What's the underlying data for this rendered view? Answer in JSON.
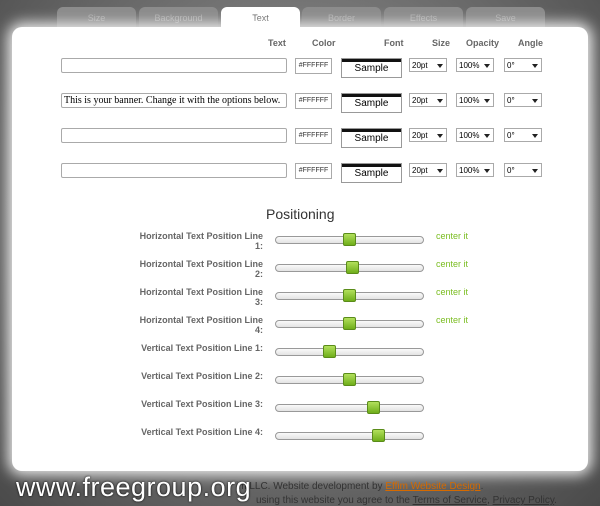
{
  "tabs": [
    "Size",
    "Background",
    "Text",
    "Border",
    "Effects",
    "Save"
  ],
  "active_tab": "Text",
  "columns": {
    "text": "Text",
    "color": "Color",
    "font": "Font",
    "size": "Size",
    "opacity": "Opacity",
    "angle": "Angle"
  },
  "rows": [
    {
      "text": "",
      "color": "#FFFFFF",
      "font": "Sample",
      "size": "20pt",
      "opacity": "100%",
      "angle": "0°"
    },
    {
      "text": "This is your banner. Change it with the options below.",
      "color": "#FFFFFF",
      "font": "Sample",
      "size": "20pt",
      "opacity": "100%",
      "angle": "0°"
    },
    {
      "text": "",
      "color": "#FFFFFF",
      "font": "Sample",
      "size": "20pt",
      "opacity": "100%",
      "angle": "0°"
    },
    {
      "text": "",
      "color": "#FFFFFF",
      "font": "Sample",
      "size": "20pt",
      "opacity": "100%",
      "angle": "0°"
    }
  ],
  "positioning": {
    "title": "Positioning",
    "center_label": "center it",
    "sliders": [
      {
        "label": "Horizontal Text Position Line 1:",
        "value": 0.5,
        "center": true
      },
      {
        "label": "Horizontal Text Position Line 2:",
        "value": 0.52,
        "center": true
      },
      {
        "label": "Horizontal Text Position Line 3:",
        "value": 0.5,
        "center": true
      },
      {
        "label": "Horizontal Text Position Line 4:",
        "value": 0.5,
        "center": true
      },
      {
        "label": "Vertical Text Position Line 1:",
        "value": 0.35,
        "center": false
      },
      {
        "label": "Vertical Text Position Line 2:",
        "value": 0.5,
        "center": false
      },
      {
        "label": "Vertical Text Position Line 3:",
        "value": 0.68,
        "center": false
      },
      {
        "label": "Vertical Text Position Line 4:",
        "value": 0.72,
        "center": false
      }
    ]
  },
  "footer": {
    "line1_prefix": "im LLC. Website development by ",
    "dev_link": "Effim Website Design",
    "line1_suffix": ".",
    "line2_prefix": "using this website you agree to the ",
    "tos_link": "Terms of Service",
    "line2_sep": ", ",
    "privacy_link": "Privacy Policy",
    "line2_suffix": "."
  },
  "watermark": "www.freegroup.org"
}
